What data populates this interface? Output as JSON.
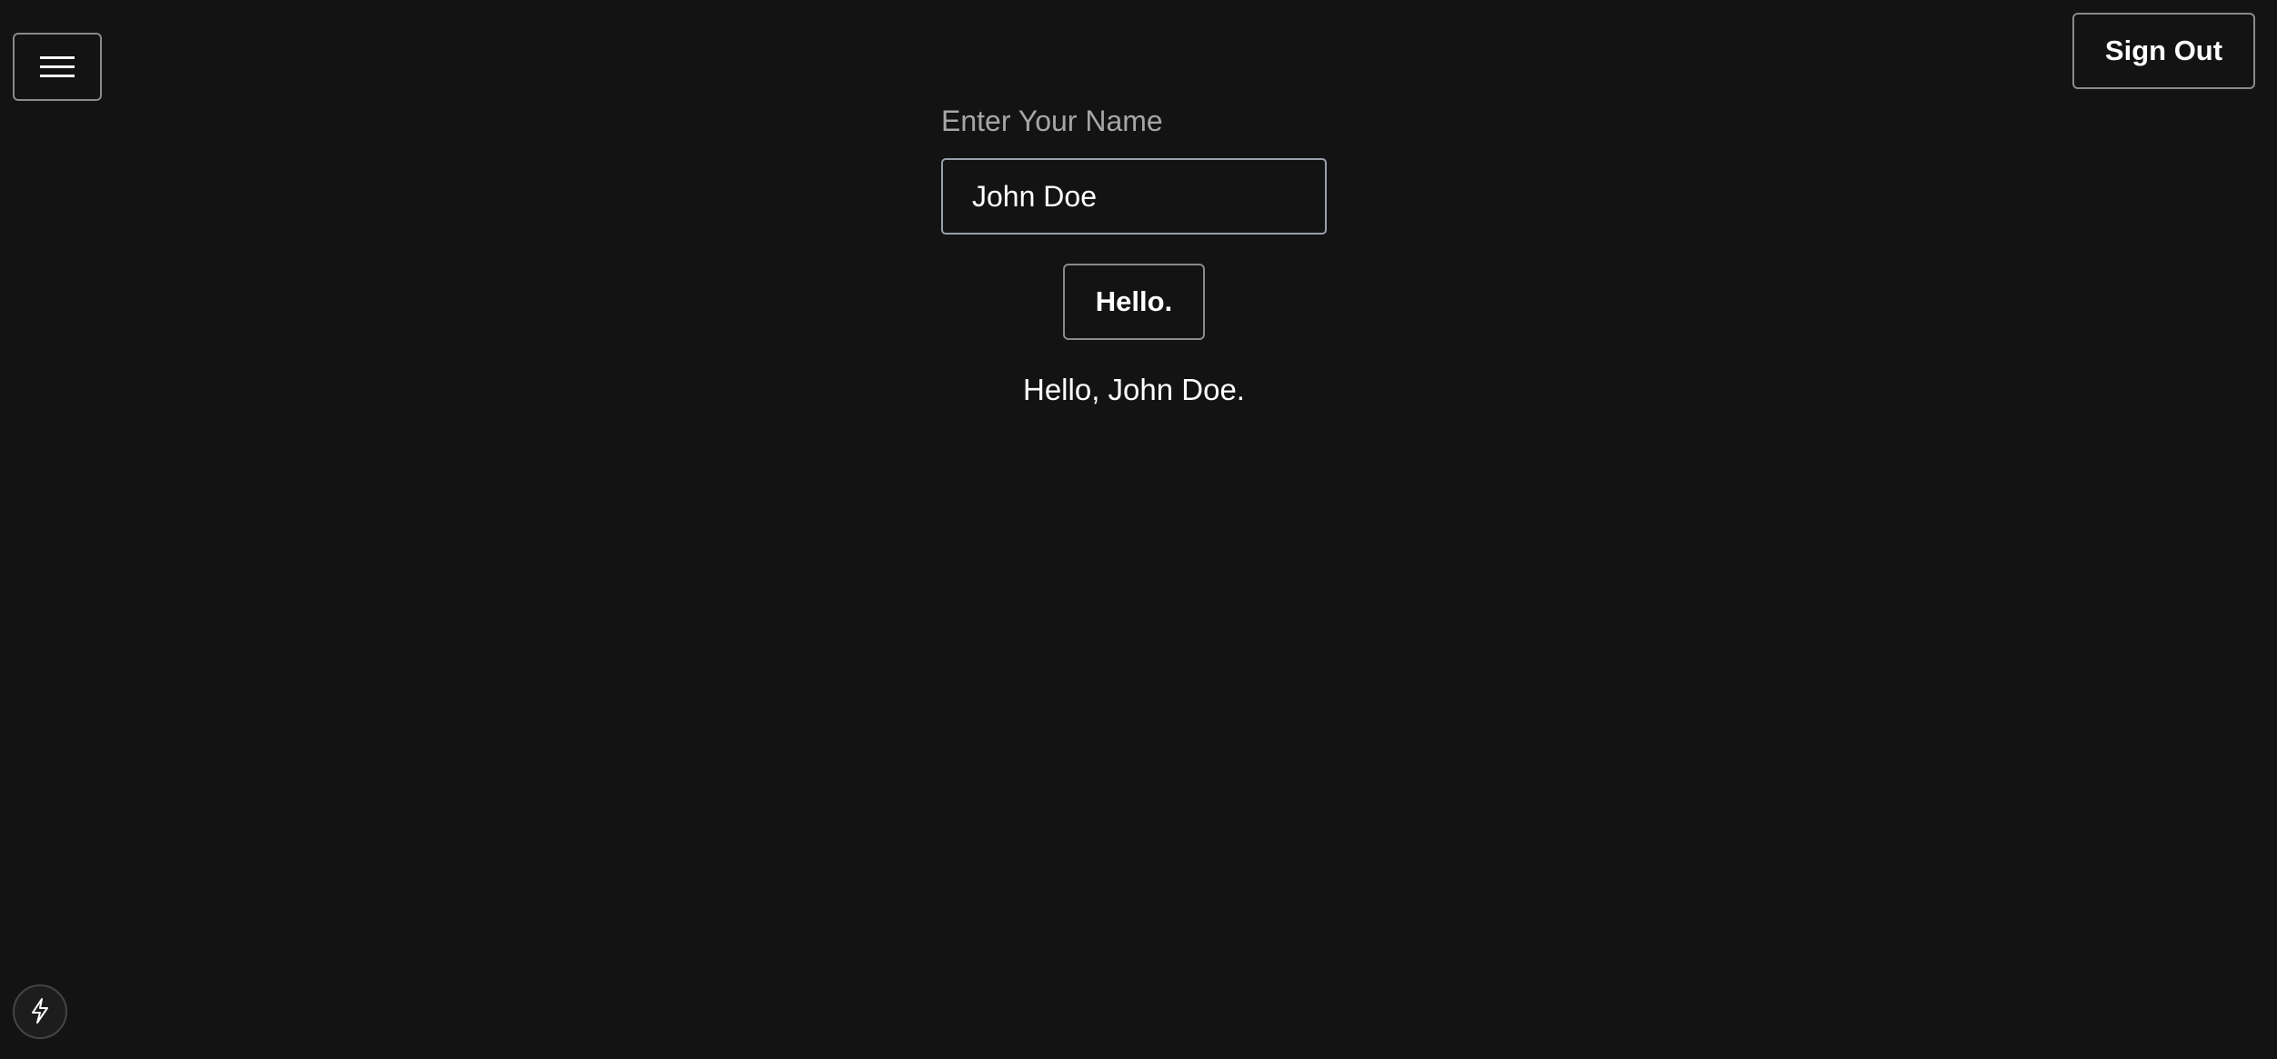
{
  "header": {
    "menu_icon": "hamburger-menu-icon",
    "sign_out_label": "Sign Out"
  },
  "form": {
    "name_label": "Enter Your Name",
    "name_value": "John Doe",
    "hello_button_label": "Hello.",
    "greeting": "Hello, John Doe."
  },
  "footer": {
    "bolt_icon": "lightning-bolt-icon"
  },
  "colors": {
    "background": "#131313",
    "text": "#ffffff",
    "label": "#a6a6a6",
    "border": "#8a8a8a"
  }
}
